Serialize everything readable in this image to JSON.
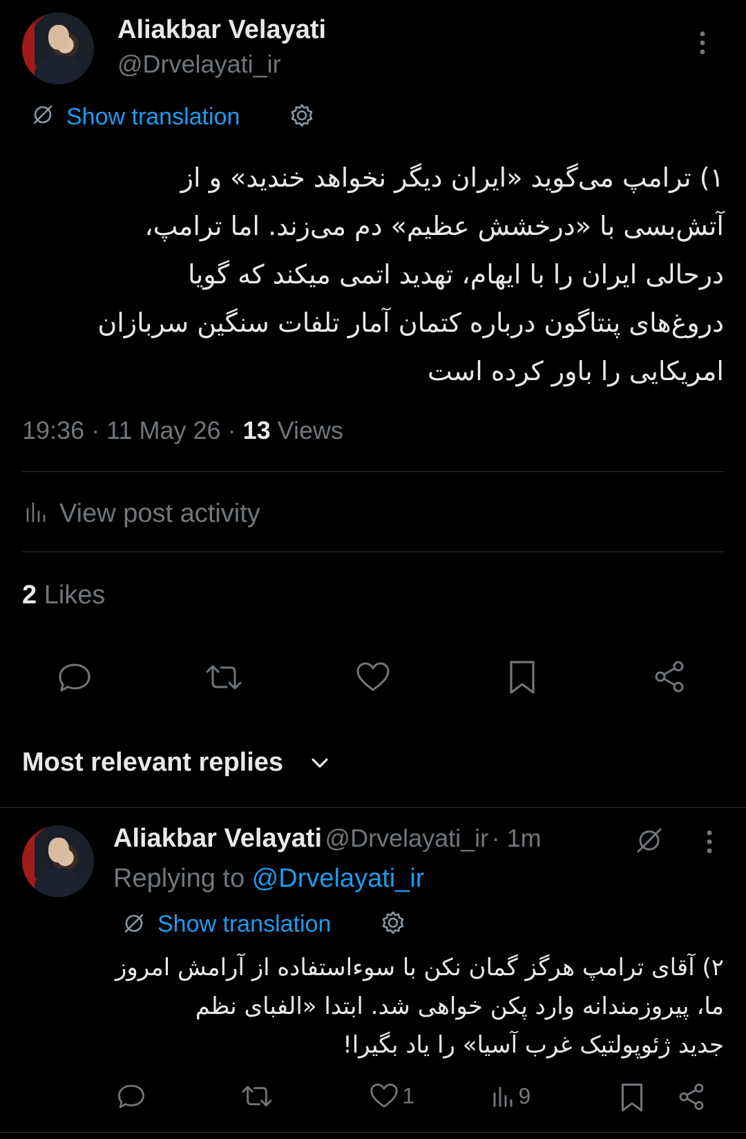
{
  "post": {
    "author_name": "Aliakbar Velayati",
    "author_handle": "@Drvelayati_ir",
    "show_translation": "Show translation",
    "text_lines": [
      "۱) ترامپ می‌گوید «ایران دیگر نخواهد خندید» و از",
      "آتش‌بسی با «درخشش عظیم» دم می‌زند. اما ترامپ،",
      "درحالی ایران را با ایهام، تهدید اتمی میکند که گویا",
      "دروغ‌های پنتاگون درباره کتمان آمار تلفات سنگین سربازان",
      "امریکایی را باور کرده است"
    ],
    "time": "19:36",
    "sep": "·",
    "date": "11 May 26",
    "views_count": "13",
    "views_label": "Views",
    "activity_label": "View post activity",
    "likes_count": "2",
    "likes_label": "Likes"
  },
  "replies_header": {
    "label": "Most relevant replies"
  },
  "reply": {
    "author_name": "Aliakbar Velayati",
    "author_handle": "@Drvelayati_ir",
    "time_ago": "· 1m",
    "replying_to_label": "Replying to",
    "replying_to_handle": "@Drvelayati_ir",
    "show_translation": "Show translation",
    "text_lines": [
      "۲) آقای ترامپ هرگز گمان نکن با سوءاستفاده از آرامش امروز",
      "ما، پیروزمندانه وارد پکن خواهی شد. ابتدا «الفبای نظم",
      "جدید ژئوپولتیک غرب آسیا» را یاد بگیرا!"
    ],
    "like_count": "1",
    "view_count": "9"
  },
  "colors": {
    "background": "#000000",
    "text": "#e7e9ea",
    "muted": "#71767b",
    "accent": "#1d9bf0",
    "divider": "#2f3336"
  },
  "icons": [
    "more-icon",
    "translate-icon",
    "settings-icon",
    "analytics-icon",
    "reply-icon",
    "repost-icon",
    "like-icon",
    "bookmark-icon",
    "share-icon",
    "chevron-down-icon",
    "grok-icon"
  ]
}
